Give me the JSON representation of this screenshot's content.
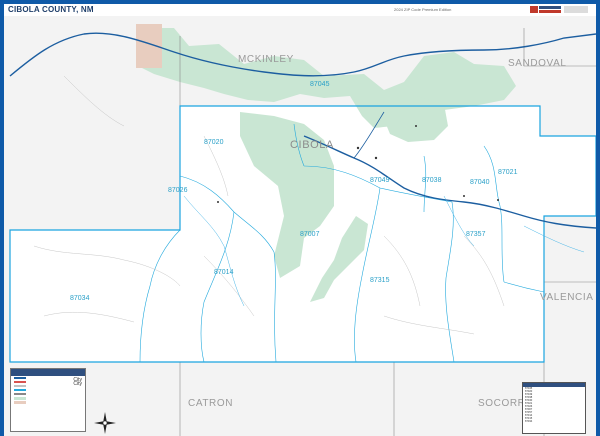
{
  "header": {
    "title": "CIBOLA COUNTY, NM",
    "edition": "2024 ZIP Code Premium Edition"
  },
  "counties": {
    "main": "CIBOLA",
    "mckinley": "MCKINLEY",
    "sandoval": "SANDOVAL",
    "valencia": "VALENCIA",
    "catron": "CATRON",
    "socorro": "SOCORRO"
  },
  "zip_codes": [
    "87045",
    "87020",
    "87049",
    "87038",
    "87040",
    "87021",
    "87026",
    "87007",
    "87357",
    "87014",
    "87315",
    "87034"
  ],
  "legend": {
    "city_label": "City",
    "city_sublabel": "City"
  },
  "colors": {
    "frame": "#0f5aa8",
    "county_fill": "#ffffff",
    "outside_fill": "#f3f3f3",
    "federal_land": "#c9e6d3",
    "zip_boundary": "#22a9dd",
    "road": "#1c5ea0",
    "title": "#1f3f6a"
  },
  "icons": {
    "north_arrow": "north-arrow-icon",
    "brand": "brand-logo-icon",
    "city_marker": "city-icon"
  }
}
